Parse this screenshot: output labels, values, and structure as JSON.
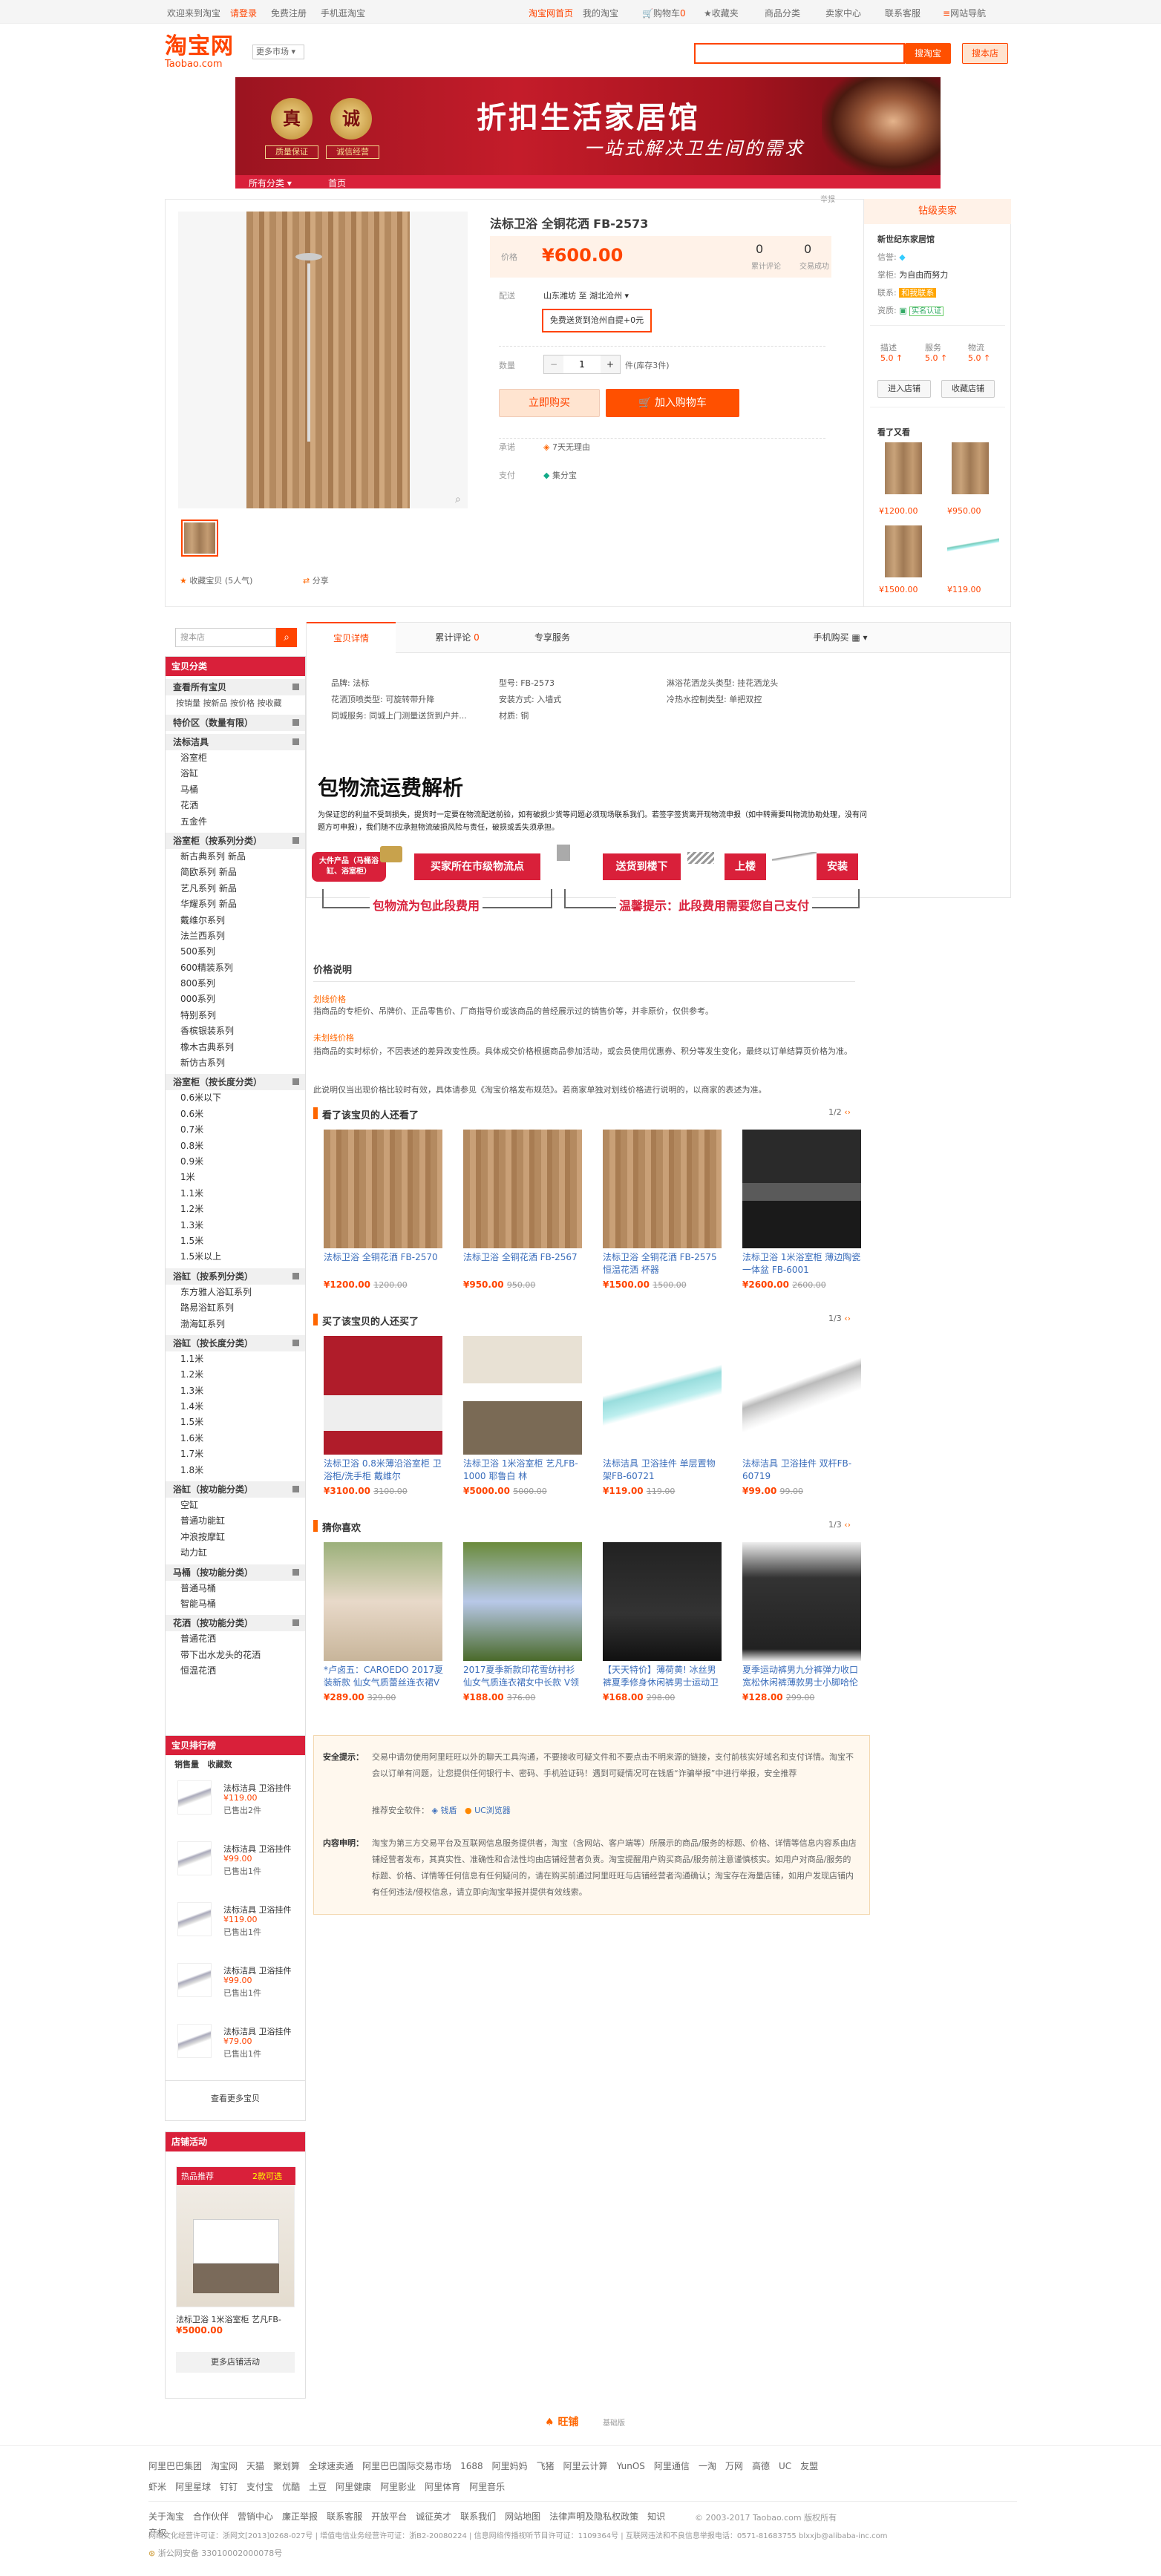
{
  "topbar": {
    "greeting": "欢迎来到淘宝",
    "login": "请登录",
    "register": "免费注册",
    "phone": "手机逛淘宝",
    "home": "淘宝网首页",
    "mytaobao": "我的淘宝",
    "cart": "购物车",
    "cart_count": "0",
    "favorites": "收藏夹",
    "categories": "商品分类",
    "seller": "卖家中心",
    "service": "联系客服",
    "sitenav": "网站导航"
  },
  "header": {
    "logo_cn": "淘宝网",
    "logo_en": "Taobao.com",
    "market": "更多市场",
    "search_btn": "搜淘宝",
    "store_search_btn": "搜本店"
  },
  "banner": {
    "seal1": "真",
    "seal2": "诚",
    "label1": "质量保证",
    "label2": "诚信经营",
    "title": "折扣生活家居馆",
    "slogan": "一站式解决卫生间的需求",
    "nav_all": "所有分类",
    "nav_home": "首页"
  },
  "report": "举报",
  "product": {
    "title": "法标卫浴 全铜花洒 FB-2573",
    "price_label": "价格",
    "price": "¥600.00",
    "reviews_count": "0",
    "reviews_label": "累计评论",
    "sales_count": "0",
    "sales_label": "交易成功",
    "delivery_label": "配送",
    "delivery_from": "山东潍坊 至",
    "delivery_to": "湖北沧州",
    "shipping_note": "免费送货到沧州自提+0元",
    "qty_label": "数量",
    "qty": "1",
    "unit": "件(库存3件)",
    "buy_now": "立即购买",
    "add_cart": "加入购物车",
    "promise_label": "承诺",
    "promise": "7天无理由",
    "pay_label": "支付",
    "pay": "集分宝",
    "fav": "收藏宝贝 (5人气)",
    "share": "分享"
  },
  "shop": {
    "level_title": "钻级卖家",
    "name": "新世纪东家居馆",
    "credit_label": "信誉:",
    "keeper_label": "掌柜:",
    "keeper": "为自由而努力",
    "contact_label": "联系:",
    "contact": "和我联系",
    "qual_label": "资质:",
    "qual": "实名认证",
    "rating_labels": [
      "描述",
      "服务",
      "物流"
    ],
    "ratings": [
      "5.0",
      "5.0",
      "5.0"
    ],
    "enter_btn": "进入店铺",
    "fav_btn": "收藏店铺",
    "also_viewed": "看了又看",
    "also_prices": [
      "¥1200.00",
      "¥950.00",
      "¥1500.00",
      "¥119.00"
    ]
  },
  "sidebar": {
    "search_placeholder": "搜本店",
    "category_title": "宝贝分类",
    "view_all": "查看所有宝贝",
    "sort_links": "按销量 按新品 按价格 按收藏",
    "special": "特价区（数量有限）",
    "groups": [
      {
        "title": "法标洁具",
        "items": [
          "浴室柜",
          "浴缸",
          "马桶",
          "花洒",
          "五金件"
        ]
      },
      {
        "title": "浴室柜（按系列分类）",
        "items": [
          "新古典系列 新品",
          "简欧系列 新品",
          "艺凡系列 新品",
          "华耀系列 新品",
          "戴维尔系列",
          "法兰西系列",
          "500系列",
          "600精装系列",
          "800系列",
          "000系列",
          "特别系列",
          "香槟银装系列",
          "橡木古典系列",
          "新仿古系列"
        ]
      },
      {
        "title": "浴室柜（按长度分类）",
        "items": [
          "0.6米以下",
          "0.6米",
          "0.7米",
          "0.8米",
          "0.9米",
          "1米",
          "1.1米",
          "1.2米",
          "1.3米",
          "1.5米",
          "1.5米以上"
        ]
      },
      {
        "title": "浴缸（按系列分类）",
        "items": [
          "东方雅人浴缸系列",
          "路易浴缸系列",
          "渤海缸系列"
        ]
      },
      {
        "title": "浴缸（按长度分类）",
        "items": [
          "1.1米",
          "1.2米",
          "1.3米",
          "1.4米",
          "1.5米",
          "1.6米",
          "1.7米",
          "1.8米"
        ]
      },
      {
        "title": "浴缸（按功能分类）",
        "items": [
          "空缸",
          "普通功能缸",
          "冲浪按摩缸",
          "动力缸"
        ]
      },
      {
        "title": "马桶（按功能分类）",
        "items": [
          "普通马桶",
          "智能马桶"
        ]
      },
      {
        "title": "花洒（按功能分类）",
        "items": [
          "普通花洒",
          "带下出水龙头的花洒",
          "恒温花洒"
        ]
      }
    ],
    "rank_title": "宝贝排行榜",
    "rank_tabs": [
      "销售量",
      "收藏数"
    ],
    "rank_items": [
      {
        "name": "法标洁具 卫浴挂件",
        "price": "¥119.00",
        "sold": "已售出2件"
      },
      {
        "name": "法标洁具 卫浴挂件",
        "price": "¥99.00",
        "sold": "已售出1件"
      },
      {
        "name": "法标洁具 卫浴挂件",
        "price": "¥119.00",
        "sold": "已售出1件"
      },
      {
        "name": "法标洁具 卫浴挂件",
        "price": "¥99.00",
        "sold": "已售出1件"
      },
      {
        "name": "法标洁具 卫浴挂件",
        "price": "¥79.00",
        "sold": "已售出1件"
      }
    ],
    "rank_more": "查看更多宝贝",
    "activity_title": "店铺活动",
    "activity_tag1": "热品推荐",
    "activity_tag2": "2款可选",
    "activity_name": "法标卫浴 1米浴室柜 艺凡FB-",
    "activity_price": "¥5000.00",
    "activity_more": "更多店铺活动"
  },
  "tabs": {
    "detail": "宝贝详情",
    "reviews": "累计评论",
    "reviews_count": "0",
    "service": "专享服务",
    "mobile": "手机购买"
  },
  "attrs": [
    "品牌: 法标",
    "型号: FB-2573",
    "淋浴花洒龙头类型: 挂花洒龙头",
    "花洒顶喷类型: 可旋转带升降",
    "安装方式: 入墙式",
    "冷热水控制类型: 单把双控",
    "同城服务: 同城上门测量送货到户并...",
    "材质: 铜"
  ],
  "logistics": {
    "title": "包物流运费解析",
    "desc": "为保证您的利益不受到损失，提货时一定要在物流配送前验，如有破损少货等问题必须现场联系我们。若签字签货离开现物流申报（如中转需要叫物流协助处理，没有问题方可申报），我们随不应承担物流破损风险与责任，破损或丢失须承担。",
    "step1": "大件产品（马桶浴缸、浴室柜）",
    "step2": "买家所在市级物流点",
    "step3": "送货到楼下",
    "step4": "上楼",
    "step5": "安装",
    "note1": "包物流为包此段费用",
    "note2": "温馨提示：此段费用需要您自己支付"
  },
  "price_desc": {
    "title": "价格说明",
    "h1": "划线价格",
    "p1": "指商品的专柜价、吊牌价、正品零售价、厂商指导价或该商品的曾经展示过的销售价等，并非原价，仅供参考。",
    "h2": "未划线价格",
    "p2": "指商品的实时标价，不因表述的差异改变性质。具体成交价格根据商品参加活动，或会员使用优惠券、积分等发生变化，最终以订单结算页价格为准。",
    "p3": "此说明仅当出现价格比较时有效，具体请参见《淘宝价格发布规范》。若商家单独对划线价格进行说明的，以商家的表述为准。"
  },
  "viewed_section": {
    "title": "看了该宝贝的人还看了",
    "page": "1/2",
    "items": [
      {
        "name": "法标卫浴 全铜花洒 FB-2570",
        "price": "¥1200.00",
        "old": "1200.00"
      },
      {
        "name": "法标卫浴 全铜花洒 FB-2567",
        "price": "¥950.00",
        "old": "950.00"
      },
      {
        "name": "法标卫浴 全铜花洒 FB-2575 恒温花洒 杯器",
        "price": "¥1500.00",
        "old": "1500.00"
      },
      {
        "name": "法标卫浴 1米浴室柜 薄边陶瓷一体盆 FB-6001",
        "price": "¥2600.00",
        "old": "2600.00"
      }
    ]
  },
  "bought_section": {
    "title": "买了该宝贝的人还买了",
    "page": "1/3",
    "items": [
      {
        "name": "法标卫浴 0.8米薄沿浴室柜 卫浴柜/洗手柜 戴维尔",
        "price": "¥3100.00",
        "old": "3100.00"
      },
      {
        "name": "法标卫浴 1米浴室柜 艺凡FB-1000 耶鲁白 林",
        "price": "¥5000.00",
        "old": "5000.00"
      },
      {
        "name": "法标洁具 卫浴挂件 单层置物架FB-60721",
        "price": "¥119.00",
        "old": "119.00"
      },
      {
        "name": "法标洁具 卫浴挂件 双杆FB-60719",
        "price": "¥99.00",
        "old": "99.00"
      }
    ]
  },
  "guess_section": {
    "title": "猜你喜欢",
    "page": "1/3",
    "items": [
      {
        "name": "*卢卤五：CAROEDO 2017夏装新款 仙女气质蕾丝连衣裙V",
        "price": "¥289.00",
        "old": "329.00"
      },
      {
        "name": "2017夏季新款印花雪纺衬衫仙女气质连衣裙女中长款 V领小",
        "price": "¥188.00",
        "old": "376.00"
      },
      {
        "name": "【天天特价】薄荷黄! 冰丝男裤夏季修身休闲裤男士运动卫",
        "price": "¥168.00",
        "old": "298.00"
      },
      {
        "name": "夏季运动裤男九分裤弹力收口宽松休闲裤薄款男士小脚哈伦",
        "price": "¥128.00",
        "old": "299.00"
      }
    ]
  },
  "safety": {
    "label1": "安全提示：",
    "text1": "交易中请勿使用阿里旺旺以外的聊天工具沟通，不要接收可疑文件和不要点击不明来源的链接，支付前核实好域名和支付详情。淘宝不会以订单有问题，让您提供任何银行卡、密码、手机验证码！遇到可疑情况可在钱盾“诈骗举报”中进行举报，安全推荐",
    "rec_label": "推荐安全软件：",
    "soft1": "钱盾",
    "soft2": "UC浏览器",
    "label2": "内容申明：",
    "text2": "淘宝为第三方交易平台及互联网信息服务提供者，淘宝（含网站、客户端等）所展示的商品/服务的标题、价格、详情等信息内容系由店铺经营者发布，其真实性、准确性和合法性均由店铺经营者负责。淘宝提醒用户购买商品/服务前注意谨慎核实。如用户对商品/服务的标题、价格、详情等任何信息有任何疑问的，请在购买前通过阿里旺旺与店铺经营者沟通确认；淘宝存在海量店铺，如用户发现店铺内有任何违法/侵权信息，请立即向淘宝举报并提供有效线索。"
  },
  "wangpu": {
    "logo": "旺铺",
    "sub": "基础版"
  },
  "footer": {
    "row1": [
      "阿里巴巴集团",
      "淘宝网",
      "天猫",
      "聚划算",
      "全球速卖通",
      "阿里巴巴国际交易市场",
      "1688",
      "阿里妈妈",
      "飞猪",
      "阿里云计算",
      "YunOS",
      "阿里通信",
      "一淘",
      "万网",
      "高德",
      "UC",
      "友盟"
    ],
    "row2": [
      "虾米",
      "阿里星球",
      "钉钉",
      "支付宝",
      "优酷",
      "土豆",
      "阿里健康",
      "阿里影业",
      "阿里体育",
      "阿里音乐"
    ],
    "row3": [
      "关于淘宝",
      "合作伙伴",
      "营销中心",
      "廉正举报",
      "联系客服",
      "开放平台",
      "诚征英才",
      "联系我们",
      "网站地图",
      "法律声明及隐私权政策",
      "知识产权"
    ],
    "copyright": "© 2003-2017 Taobao.com 版权所有",
    "license": "网络文化经营许可证：浙网文[2013]0268-027号 | 增值电信业务经营许可证：浙B2-20080224 | 信息网络传播视听节目许可证：1109364号 | 互联网违法和不良信息举报电话：0571-81683755 blxxjb@alibaba-inc.com",
    "police": "浙公网安备 33010002000078号"
  },
  "colors": {
    "brand": "#ff4400",
    "red": "#d9203a",
    "orange_btn": "#ff5000",
    "buy_now_bg": "#ffe4d0"
  }
}
